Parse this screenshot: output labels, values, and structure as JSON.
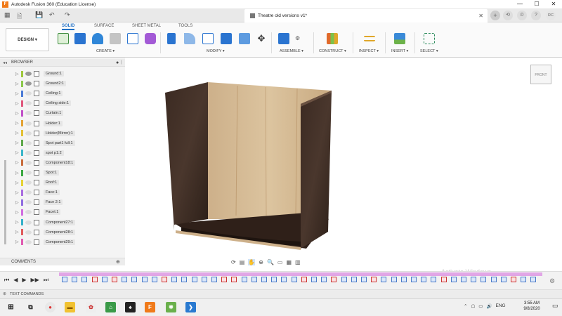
{
  "window": {
    "title": "Autodesk Fusion 360 (Education License)",
    "minimize": "—",
    "maximize": "☐",
    "close": "✕"
  },
  "doc": {
    "tab_title": "Theatre old versions v1*",
    "close": "✕",
    "add": "+",
    "user_initials": "RC"
  },
  "ribbon": {
    "design_label": "DESIGN",
    "tabs": [
      "SOLID",
      "SURFACE",
      "SHEET METAL",
      "TOOLS"
    ],
    "groups": [
      "CREATE",
      "MODIFY",
      "ASSEMBLE",
      "CONSTRUCT",
      "INSPECT",
      "INSERT",
      "SELECT"
    ]
  },
  "browser": {
    "title": "BROWSER",
    "items": [
      {
        "label": "Ground:1",
        "color": "#a0c83c"
      },
      {
        "label": "Ground2:1",
        "color": "#8cc84b"
      },
      {
        "label": "Ceiling:1",
        "color": "#4a7ad6"
      },
      {
        "label": "Ceiling side:1",
        "color": "#e0557a"
      },
      {
        "label": "Curtain:1",
        "color": "#c04ec8"
      },
      {
        "label": "Holder:1",
        "color": "#e3a233"
      },
      {
        "label": "Holder(Mirror):1",
        "color": "#e3c033"
      },
      {
        "label": "Spot part1 full:1",
        "color": "#5ea84a"
      },
      {
        "label": "spot p1:2",
        "color": "#39b5c9"
      },
      {
        "label": "Component18:1",
        "color": "#c96b3a"
      },
      {
        "label": "Spot:1",
        "color": "#3ba841"
      },
      {
        "label": "Roof:1",
        "color": "#e6d233"
      },
      {
        "label": "Face:1",
        "color": "#a86be0"
      },
      {
        "label": "Face 2:1",
        "color": "#8f6be0"
      },
      {
        "label": "Facet:1",
        "color": "#d06be0"
      },
      {
        "label": "Component27:1",
        "color": "#33b0c9"
      },
      {
        "label": "Component28:1",
        "color": "#e05a5a"
      },
      {
        "label": "Component29:1",
        "color": "#e05ab0"
      }
    ]
  },
  "comments": {
    "title": "COMMENTS"
  },
  "text_commands": {
    "title": "TEXT COMMANDS"
  },
  "viewcube_label": "FRONT",
  "watermark": "Activate Windows",
  "clock": {
    "time": "3:55 AM",
    "date": "9/8/2020"
  },
  "tray": {
    "lang": "ENG"
  }
}
